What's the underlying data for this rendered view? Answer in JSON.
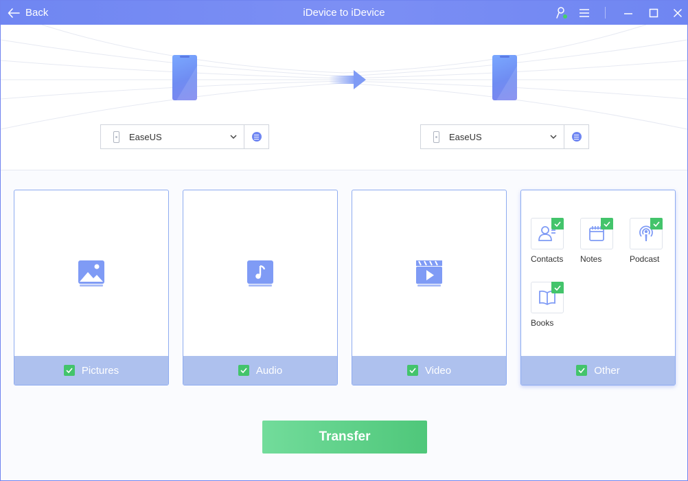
{
  "titlebar": {
    "back_label": "Back",
    "title": "iDevice to iDevice",
    "icons": [
      "user-status-icon",
      "menu-icon",
      "minimize-icon",
      "maximize-icon",
      "close-icon"
    ]
  },
  "source_device": {
    "name": "EaseUS"
  },
  "target_device": {
    "name": "EaseUS"
  },
  "categories": [
    {
      "label": "Pictures",
      "checked": true
    },
    {
      "label": "Audio",
      "checked": true
    },
    {
      "label": "Video",
      "checked": true
    },
    {
      "label": "Other",
      "checked": true
    }
  ],
  "other_items": [
    {
      "label": "Contacts",
      "checked": true
    },
    {
      "label": "Notes",
      "checked": true
    },
    {
      "label": "Podcast",
      "checked": true
    },
    {
      "label": "Books",
      "checked": true
    }
  ],
  "transfer_label": "Transfer",
  "colors": {
    "accent": "#6f86f2",
    "card_footer": "#aec1ee",
    "check_green": "#43c46b",
    "transfer_start": "#72dc9b",
    "transfer_end": "#4fc77a"
  }
}
